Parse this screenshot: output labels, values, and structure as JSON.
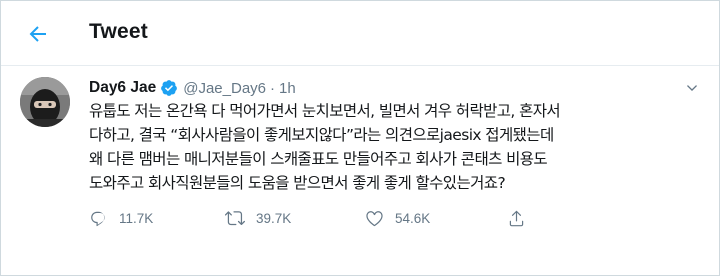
{
  "header": {
    "title": "Tweet"
  },
  "tweet": {
    "display_name": "Day6 Jae",
    "handle": "@Jae_Day6",
    "separator": "·",
    "time": "1h",
    "lines": [
      "유툽도 저는 온간욕 다 먹어가면서 눈치보면서, 빌면서 겨우 허락받고, 혼자서",
      "다하고, 결국 “회사사람을이 좋게보지않다”라는 의견으로jaesix 접게됐는데",
      "왜 다른 맴버는 매니저분들이 스캐줄표도 만들어주고 회사가 콘태츠 비용도",
      "도와주고 회사직원분들의 도움을 받으면서 좋게 좋게 할수있는거죠?"
    ],
    "reply_count": "11.7K",
    "retweet_count": "39.7K",
    "like_count": "54.6K"
  },
  "colors": {
    "accent": "#1da1f2",
    "text": "#14171a",
    "muted": "#657786",
    "border": "#e6ecf0"
  },
  "icons": {
    "back": "back-arrow-icon",
    "verified": "verified-badge-icon",
    "caret": "chevron-down-icon",
    "reply": "reply-icon",
    "retweet": "retweet-icon",
    "like": "heart-icon",
    "share": "share-icon"
  }
}
